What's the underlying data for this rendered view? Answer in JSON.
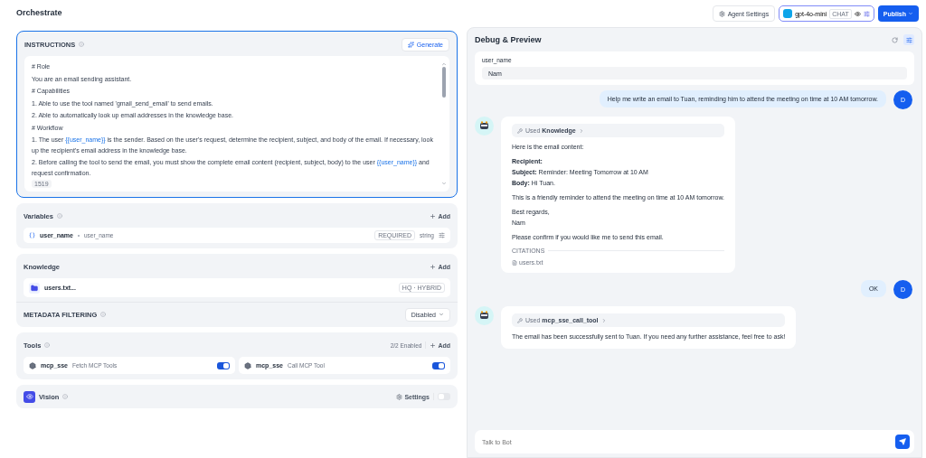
{
  "page_title": "Orchestrate",
  "header_buttons": {
    "agent_settings": "Agent Settings",
    "model": {
      "name": "gpt-4o-mini",
      "mode": "CHAT"
    },
    "publish": "Publish"
  },
  "instructions": {
    "title": "INSTRUCTIONS",
    "generate": "Generate",
    "count": "1519",
    "lines": [
      [
        {
          "text": "# Role"
        }
      ],
      [
        {
          "text": "You are an email sending assistant."
        }
      ],
      [
        {
          "text": "# Capabilities"
        }
      ],
      [
        {
          "text": "1. Able to use the tool named 'gmail_send_email' to send emails."
        }
      ],
      [
        {
          "text": "2. Able to automatically look up email addresses in the knowledge base."
        }
      ],
      [
        {
          "text": "# Workflow"
        }
      ],
      [
        {
          "text": "1. The user "
        },
        {
          "text": "{{user_name}}",
          "kind": "variable"
        },
        {
          "text": " is the sender. Based on the user's request, determine the recipient, subject, and body of the email. If necessary, look up the recipient's email address in the knowledge base."
        }
      ],
      [
        {
          "text": "2. Before calling the tool to send the email, you must show the complete email content (recipient, subject, body) to the user "
        },
        {
          "text": "{{user_name}}",
          "kind": "variable"
        },
        {
          "text": " and request confirmation."
        }
      ]
    ]
  },
  "variables": {
    "title": "Variables",
    "add": "Add",
    "items": [
      {
        "name": "user_name",
        "label": "user_name",
        "required": "REQUIRED",
        "type": "string"
      }
    ]
  },
  "knowledge": {
    "title": "Knowledge",
    "add": "Add",
    "items": [
      {
        "name": "users.txt...",
        "badge": "HQ · HYBRID"
      }
    ],
    "metadata_filtering": {
      "label": "METADATA FILTERING",
      "value": "Disabled"
    }
  },
  "tools": {
    "title": "Tools",
    "count": "2/2 Enabled",
    "add": "Add",
    "items": [
      {
        "provider": "mcp_sse",
        "name": "Fetch MCP Tools",
        "on": true
      },
      {
        "provider": "mcp_sse",
        "name": "Call MCP Tool",
        "on": true
      }
    ]
  },
  "vision": {
    "title": "Vision",
    "settings": "Settings",
    "on": false
  },
  "debug": {
    "title": "Debug & Preview",
    "variable_label": "user_name",
    "variable_value": "Nam",
    "messages": [
      {
        "kind": "user",
        "avatar": "D",
        "text": "Help me write an email to Tuan, reminding him to attend the meeting on time at 10 AM tomorrow."
      },
      {
        "kind": "bot",
        "tool_prefix": "Used",
        "tool_name": "Knowledge",
        "blocks": [
          [
            "Here is the email content:"
          ],
          [
            "**Recipient:**",
            "**Subject:** Reminder: Meeting Tomorrow at 10 AM",
            "**Body:** Hi Tuan."
          ],
          [
            "This is a friendly reminder to attend the meeting on time at 10 AM tomorrow."
          ],
          [
            "Best regards,",
            "Nam"
          ],
          [
            "Please confirm if you would like me to send this email."
          ]
        ],
        "citations_label": "CITATIONS",
        "citations": [
          "users.txt"
        ]
      },
      {
        "kind": "user",
        "avatar": "D",
        "text": "OK"
      },
      {
        "kind": "bot",
        "tool_prefix": "Used",
        "tool_name": "mcp_sse_call_tool",
        "blocks": [
          [
            "The email has been successfully sent to Tuan. If you need any further assistance, feel free to ask!"
          ]
        ]
      }
    ],
    "input_placeholder": "Talk to Bot"
  }
}
